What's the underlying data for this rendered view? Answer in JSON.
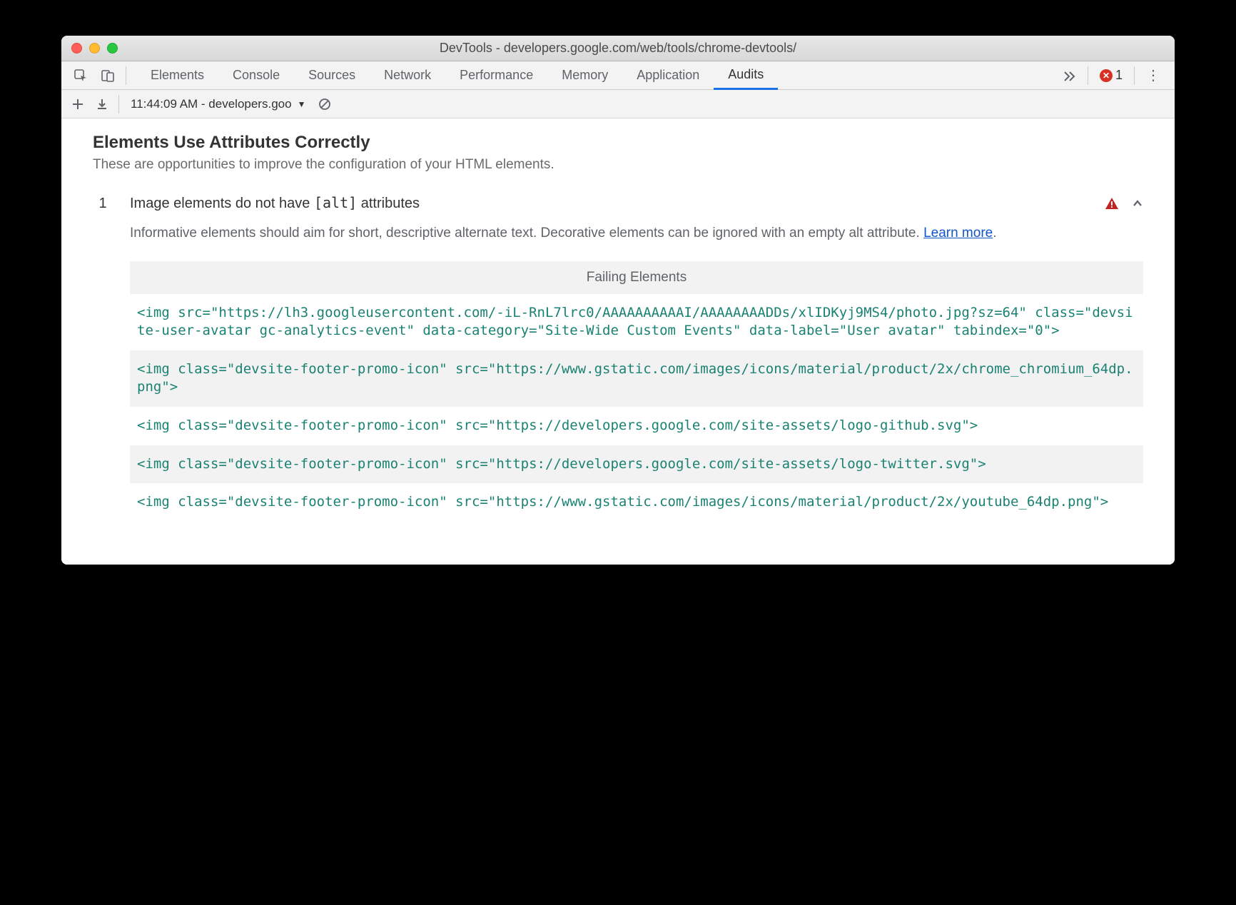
{
  "window": {
    "title": "DevTools - developers.google.com/web/tools/chrome-devtools/"
  },
  "tabs": {
    "items": [
      "Elements",
      "Console",
      "Sources",
      "Network",
      "Performance",
      "Memory",
      "Application",
      "Audits"
    ],
    "active": "Audits",
    "error_count": "1"
  },
  "subbar": {
    "dropdown_label": "11:44:09 AM - developers.goo"
  },
  "section": {
    "title": "Elements Use Attributes Correctly",
    "subtitle": "These are opportunities to improve the configuration of your HTML elements."
  },
  "audit": {
    "number": "1",
    "title_pre": "Image elements do not have ",
    "title_code": "[alt]",
    "title_post": " attributes",
    "desc_pre": "Informative elements should aim for short, descriptive alternate text. Decorative elements can be ignored with an empty alt attribute. ",
    "learn_more": "Learn more",
    "desc_post": ".",
    "failing_header": "Failing Elements",
    "failing_items": [
      "<img src=\"https://lh3.googleusercontent.com/-iL-RnL7lrc0/AAAAAAAAAAI/AAAAAAAADDs/xlIDKyj9MS4/photo.jpg?sz=64\" class=\"devsite-user-avatar gc-analytics-event\" data-category=\"Site-Wide Custom Events\" data-label=\"User avatar\" tabindex=\"0\">",
      "<img class=\"devsite-footer-promo-icon\" src=\"https://www.gstatic.com/images/icons/material/product/2x/chrome_chromium_64dp.png\">",
      "<img class=\"devsite-footer-promo-icon\" src=\"https://developers.google.com/site-assets/logo-github.svg\">",
      "<img class=\"devsite-footer-promo-icon\" src=\"https://developers.google.com/site-assets/logo-twitter.svg\">",
      "<img class=\"devsite-footer-promo-icon\" src=\"https://www.gstatic.com/images/icons/material/product/2x/youtube_64dp.png\">"
    ]
  }
}
